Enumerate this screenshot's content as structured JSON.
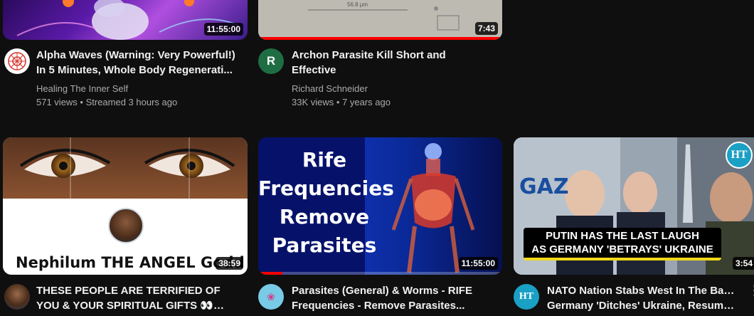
{
  "videos": [
    {
      "title_line1": "Alpha Waves (Warning: Very Powerful!)",
      "title_line2": "In 5 Minutes, Whole Body Regenerati...",
      "channel": "Healing The Inner Self",
      "stats": "571 views • Streamed 3 hours ago",
      "duration": "11:55:00",
      "avatar_icon": "mandala-logo-icon"
    },
    {
      "title_line1": "Archon Parasite Kill Short and",
      "title_line2": "Effective",
      "channel": "Richard Schneider",
      "stats": "33K views • 7 years ago",
      "duration": "7:43",
      "thumb_text": "56.8 µm",
      "avatar_letter": "R",
      "watched_fraction": 1.0
    },
    {
      "title_line1": "THESE PEOPLE ARE TERRIFIED OF",
      "title_line2": "YOU & YOUR SPIRITUAL GIFTS 👀🧿...",
      "channel": "",
      "stats": "",
      "duration": "38:59",
      "thumb_text": "Nephilum THE ANGEL Godd",
      "avatar_icon": "woman-portrait-avatar"
    },
    {
      "title_line1": "Parasites (General) & Worms - RIFE",
      "title_line2": "Frequencies - Remove Parasites...",
      "duration": "11:55:00",
      "thumb_lines": [
        "Rife",
        "Frequencies",
        "Remove",
        "Parasites"
      ],
      "avatar_icon": "lotus-icon",
      "watched_fraction": 0.1
    },
    {
      "title_line1": "NATO Nation Stabs West In The Back;",
      "title_line2": "Germany 'Ditches' Ukraine, Resumes...",
      "duration": "3:54",
      "thumb_banner_line1": "PUTIN HAS THE LAST LAUGH",
      "thumb_banner_line2": "AS GERMANY 'BETRAYS' UKRAINE",
      "thumb_logo": "HT",
      "thumb_sign": "GAZ",
      "avatar_letters": "HT"
    }
  ],
  "colors": {
    "background": "#0f0f0f",
    "progress": "#ff0000",
    "meta": "#aaaaaa",
    "ht_logo": "#1aa0c4"
  }
}
